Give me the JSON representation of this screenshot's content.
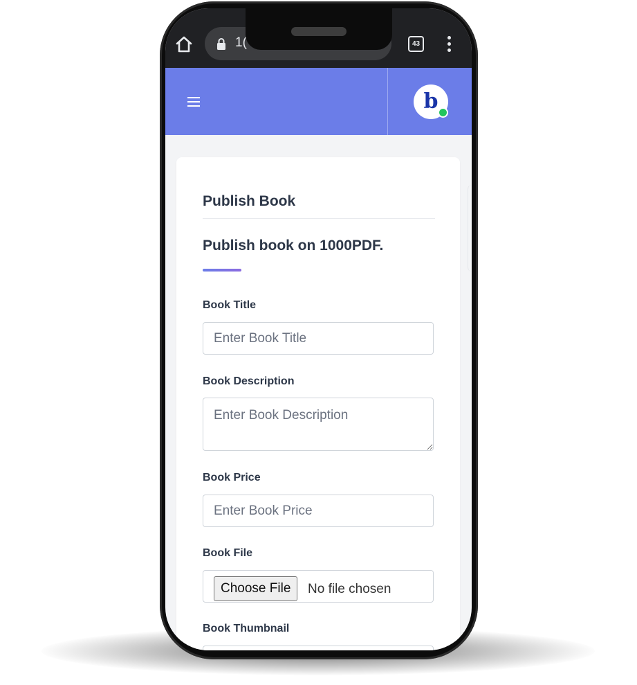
{
  "browser": {
    "url_partial": "1(",
    "tab_count": "43",
    "icons": [
      "home-icon",
      "lock-icon",
      "tabs-icon",
      "more-vert-icon"
    ]
  },
  "app_header": {
    "logo_letter": "b",
    "accent_color": "#6b7de8",
    "status_color": "#22c55e",
    "icons": [
      "menu-icon",
      "avatar"
    ]
  },
  "page": {
    "title": "Publish Book",
    "subtitle": "Publish book on 1000PDF."
  },
  "form": {
    "title_label": "Book Title",
    "title_placeholder": "Enter Book Title",
    "description_label": "Book Description",
    "description_placeholder": "Enter Book Description",
    "price_label": "Book Price",
    "price_placeholder": "Enter Book Price",
    "file_label": "Book File",
    "file_button": "Choose File",
    "file_status": "No file chosen",
    "thumbnail_label": "Book Thumbnail"
  }
}
